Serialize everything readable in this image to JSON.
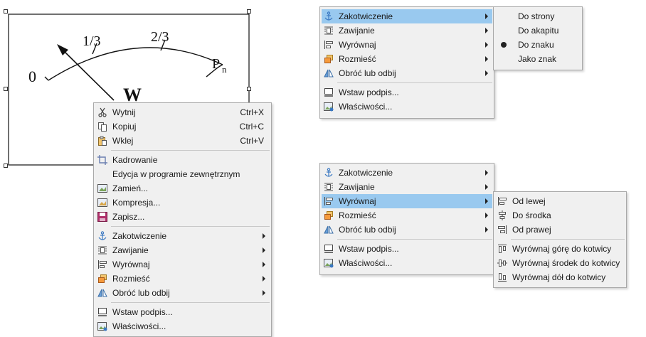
{
  "diagram": {
    "label_0": "0",
    "label_1_3": "1/3",
    "label_2_3": "2/3",
    "label_pn": "P",
    "label_pn_sub": "n",
    "label_w": "W"
  },
  "context_menu": {
    "items": [
      {
        "label": "Wytnij",
        "shortcut": "Ctrl+X",
        "icon": "cut-icon"
      },
      {
        "label": "Kopiuj",
        "shortcut": "Ctrl+C",
        "icon": "copy-icon"
      },
      {
        "label": "Wklej",
        "shortcut": "Ctrl+V",
        "icon": "paste-icon"
      },
      {
        "label": "Kadrowanie",
        "icon": "crop-icon"
      },
      {
        "label": "Edycja w programie zewnętrznym"
      },
      {
        "label": "Zamień...",
        "icon": "replace-image-icon"
      },
      {
        "label": "Kompresja...",
        "icon": "compress-image-icon"
      },
      {
        "label": "Zapisz...",
        "icon": "save-icon"
      },
      {
        "label": "Zakotwiczenie",
        "icon": "anchor-icon"
      },
      {
        "label": "Zawijanie",
        "icon": "wrap-icon"
      },
      {
        "label": "Wyrównaj",
        "icon": "align-icon"
      },
      {
        "label": "Rozmieść",
        "icon": "arrange-icon"
      },
      {
        "label": "Obróć lub odbij",
        "icon": "rotate-flip-icon"
      },
      {
        "label": "Wstaw podpis...",
        "icon": "caption-icon"
      },
      {
        "label": "Właściwości...",
        "icon": "properties-icon"
      }
    ]
  },
  "menu_top": {
    "items": [
      {
        "label": "Zakotwiczenie"
      },
      {
        "label": "Zawijanie"
      },
      {
        "label": "Wyrównaj"
      },
      {
        "label": "Rozmieść"
      },
      {
        "label": "Obróć lub odbij"
      },
      {
        "label": "Wstaw podpis..."
      },
      {
        "label": "Właściwości..."
      }
    ],
    "highlighted": "Zakotwiczenie"
  },
  "anchor_submenu": {
    "items": [
      {
        "label": "Do strony"
      },
      {
        "label": "Do akapitu"
      },
      {
        "label": "Do znaku",
        "selected": true
      },
      {
        "label": "Jako znak"
      }
    ]
  },
  "menu_bottom": {
    "items": [
      {
        "label": "Zakotwiczenie"
      },
      {
        "label": "Zawijanie"
      },
      {
        "label": "Wyrównaj"
      },
      {
        "label": "Rozmieść"
      },
      {
        "label": "Obróć lub odbij"
      },
      {
        "label": "Wstaw podpis..."
      },
      {
        "label": "Właściwości..."
      }
    ],
    "highlighted": "Wyrównaj"
  },
  "align_submenu": {
    "items": [
      {
        "label": "Od lewej",
        "icon": "align-left-icon"
      },
      {
        "label": "Do środka",
        "icon": "align-center-icon"
      },
      {
        "label": "Od prawej",
        "icon": "align-right-icon"
      },
      {
        "label": "Wyrównaj górę do kotwicy",
        "icon": "align-top-anchor-icon"
      },
      {
        "label": "Wyrównaj środek do kotwicy",
        "icon": "align-middle-anchor-icon"
      },
      {
        "label": "Wyrównaj dół do kotwicy",
        "icon": "align-bottom-anchor-icon"
      }
    ]
  },
  "colors": {
    "highlight": "#99c9ef",
    "menu_bg": "#f0f0f0",
    "menu_border": "#a9a9a9"
  }
}
